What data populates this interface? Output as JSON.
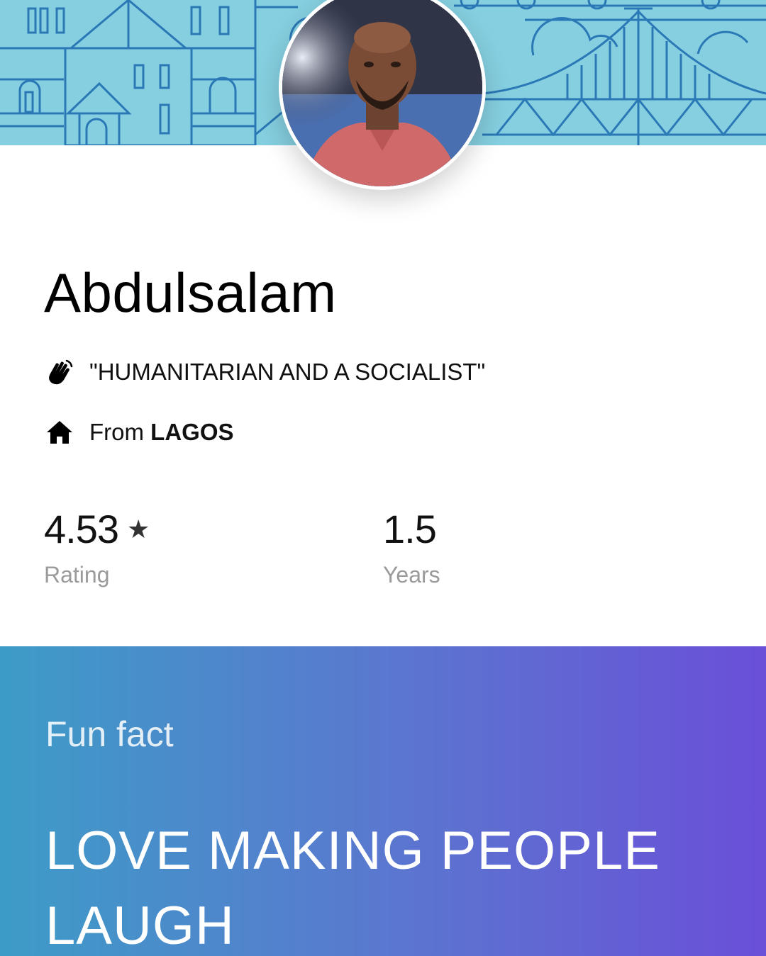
{
  "profile": {
    "name": "Abdulsalam",
    "tagline": "\"HUMANITARIAN AND A SOCIALIST\"",
    "from_prefix": "From",
    "hometown": "LAGOS"
  },
  "stats": {
    "rating_value": "4.53",
    "rating_star": "★",
    "rating_label": "Rating",
    "years_value": "1.5",
    "years_label": "Years"
  },
  "fun_fact": {
    "label": "Fun fact",
    "text": "LOVE MAKING PEOPLE LAUGH"
  },
  "icons": {
    "tagline": "waving-hand-icon",
    "hometown": "home-icon"
  },
  "colors": {
    "banner": "#85cfe0",
    "banner_lines": "#2a78b5",
    "gradient_start": "#3d9cc7",
    "gradient_end": "#6a4fd8",
    "label_gray": "#9a9a9a"
  }
}
